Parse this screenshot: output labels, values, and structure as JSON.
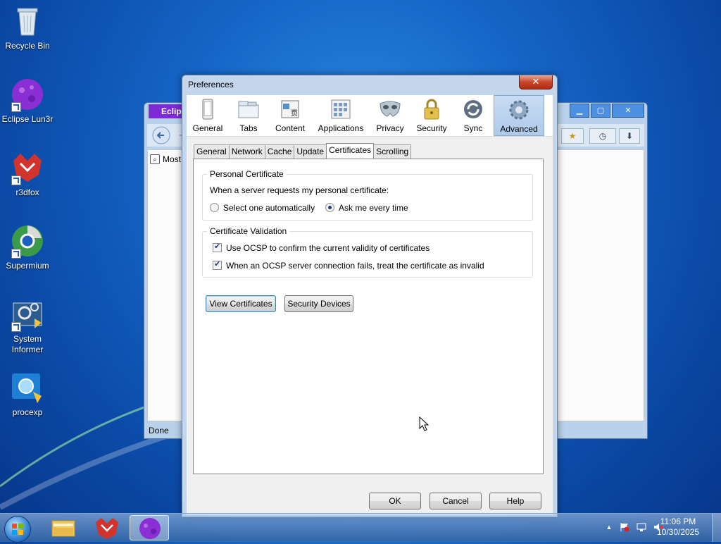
{
  "desktop": {
    "icons": [
      {
        "label": "Recycle Bin"
      },
      {
        "label": "Eclipse Lun3r"
      },
      {
        "label": "r3dfox"
      },
      {
        "label": "Supermium"
      },
      {
        "label": "System Informer"
      },
      {
        "label": "procexp"
      }
    ]
  },
  "background_window": {
    "title": "Eclips",
    "address": "Most",
    "status": "Done",
    "controls": {
      "minimize": "▁",
      "maximize": "▢",
      "close": "✕"
    }
  },
  "dialog": {
    "title": "Preferences",
    "close_symbol": "✕",
    "panes": [
      {
        "label": "General"
      },
      {
        "label": "Tabs"
      },
      {
        "label": "Content"
      },
      {
        "label": "Applications"
      },
      {
        "label": "Privacy"
      },
      {
        "label": "Security"
      },
      {
        "label": "Sync"
      },
      {
        "label": "Advanced",
        "selected": true
      }
    ],
    "tabs": [
      {
        "label": "General"
      },
      {
        "label": "Network"
      },
      {
        "label": "Cache"
      },
      {
        "label": "Update"
      },
      {
        "label": "Certificates",
        "selected": true
      },
      {
        "label": "Scrolling"
      }
    ],
    "personal_certificate": {
      "heading": "Personal Certificate",
      "prompt": "When a server requests my personal certificate:",
      "option_auto": "Select one automatically",
      "option_ask": "Ask me every time",
      "selected": "Ask me every time"
    },
    "certificate_validation": {
      "heading": "Certificate Validation",
      "ocsp_confirm": {
        "label": "Use OCSP to confirm the current validity of certificates",
        "checked": true
      },
      "ocsp_fail": {
        "label": "When an OCSP server connection fails, treat the certificate as invalid",
        "checked": true
      }
    },
    "buttons": {
      "view_certificates": "View Certificates",
      "security_devices": "Security Devices",
      "ok": "OK",
      "cancel": "Cancel",
      "help": "Help"
    }
  },
  "taskbar": {
    "time": "11:06 PM",
    "date": "10/30/2025",
    "tray_arrow": "▲"
  },
  "colors": {
    "desktop_blue": "#1566c8",
    "accent": "#3c7fb1",
    "close_red": "#c7462b"
  }
}
